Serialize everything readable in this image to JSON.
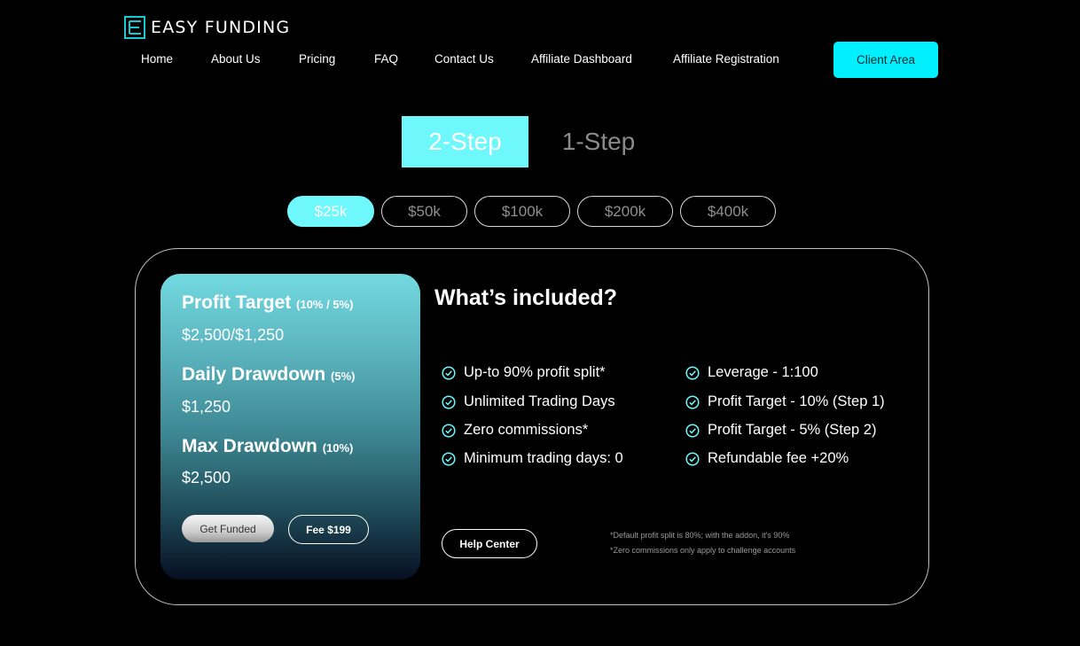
{
  "brand": {
    "name": "EASY FUNDING",
    "icon": "logo-e-icon",
    "accent": "#00f0ff"
  },
  "nav": [
    "Home",
    "About Us",
    "Pricing",
    "FAQ",
    "Contact Us",
    "Affiliate Dashboard",
    "Affiliate Registration"
  ],
  "client_area": "Client Area",
  "steps": {
    "active": "2-Step",
    "inactive": "1-Step"
  },
  "accounts": {
    "options": [
      "$25k",
      "$50k",
      "$100k",
      "$200k",
      "$400k"
    ],
    "selected": "$25k"
  },
  "plan": {
    "profit_target": {
      "label": "Profit Target",
      "pct": "(10% / 5%)",
      "value": "$2,500/$1,250"
    },
    "daily_drawdown": {
      "label": "Daily Drawdown",
      "pct": "(5%)",
      "value": "$1,250"
    },
    "max_drawdown": {
      "label": "Max Drawdown",
      "pct": "(10%)",
      "value": "$2,500"
    },
    "get_funded": "Get Funded",
    "fee": "Fee $199"
  },
  "included": {
    "title": "What’s included?",
    "left": [
      "Up-to 90% profit split*",
      "Unlimited Trading Days",
      "Zero commissions*",
      "Minimum trading days: 0"
    ],
    "right": [
      "Leverage - 1:100",
      "Profit Target - 10% (Step 1)",
      "Profit Target - 5% (Step 2)",
      "Refundable fee +20%"
    ],
    "icon": "check-circle-icon"
  },
  "help_center": "Help Center",
  "notes": [
    "*Default profit split is 80%; with the addon, it's 90%",
    "*Zero commissions only apply to challenge accounts"
  ]
}
